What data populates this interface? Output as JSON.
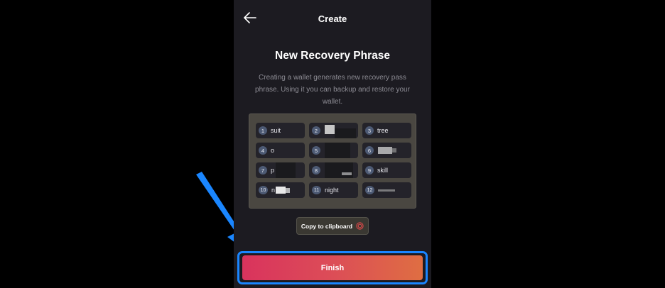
{
  "header": {
    "back_icon": "arrow-left-icon",
    "title": "Create"
  },
  "content": {
    "title": "New Recovery Phrase",
    "description": "Creating a wallet generates new recovery pass phrase. Using it you can backup and restore your wallet."
  },
  "phrase": {
    "words": [
      {
        "num": "1",
        "text": "suit"
      },
      {
        "num": "2",
        "text": ""
      },
      {
        "num": "3",
        "text": "tree"
      },
      {
        "num": "4",
        "text": "o"
      },
      {
        "num": "5",
        "text": ""
      },
      {
        "num": "6",
        "text": ""
      },
      {
        "num": "7",
        "text": "p"
      },
      {
        "num": "8",
        "text": ""
      },
      {
        "num": "9",
        "text": "skill"
      },
      {
        "num": "10",
        "text": "n"
      },
      {
        "num": "11",
        "text": "night"
      },
      {
        "num": "12",
        "text": ""
      }
    ]
  },
  "copy": {
    "label": "Copy to clipboard",
    "icon": "copy-icon"
  },
  "finish": {
    "label": "Finish"
  },
  "colors": {
    "accent_highlight": "#1a86ff",
    "finish_gradient_start": "#d9335d",
    "finish_gradient_end": "#df6e42",
    "panel_background": "#1c1b21"
  }
}
